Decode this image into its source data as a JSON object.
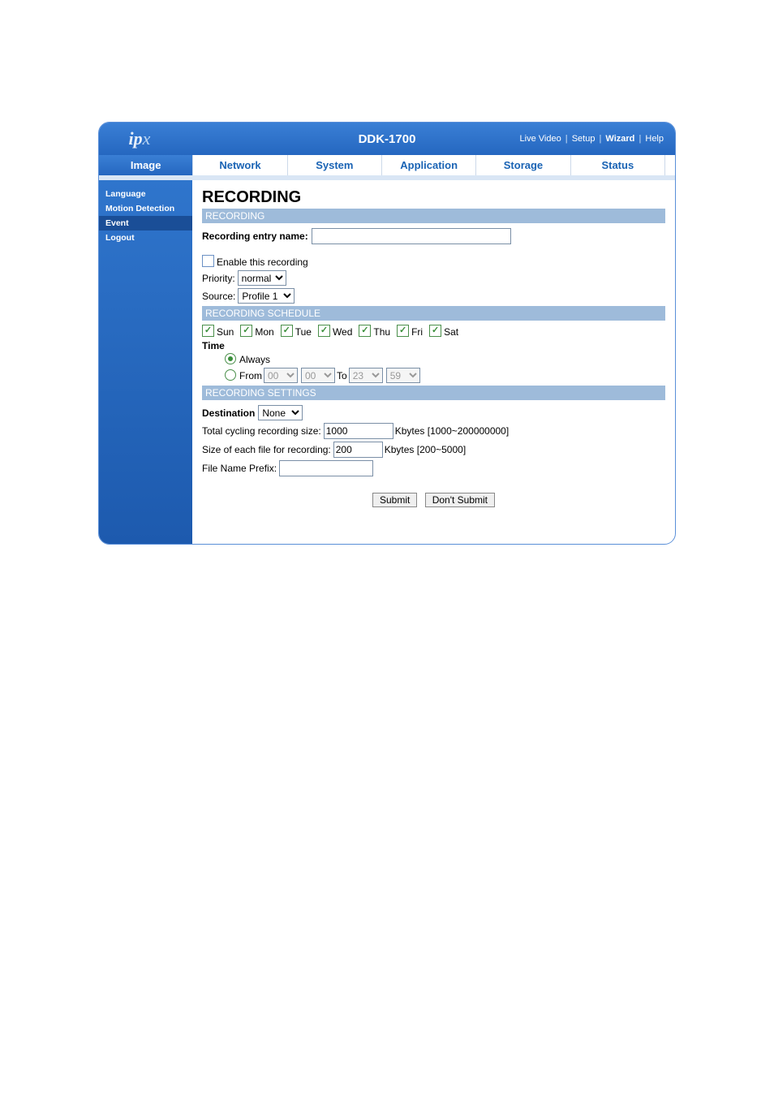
{
  "header": {
    "logo": "ipx",
    "title": "DDK-1700",
    "links": {
      "live": "Live Video",
      "setup": "Setup",
      "wizard": "Wizard",
      "help": "Help"
    }
  },
  "tabs": {
    "image": "Image",
    "network": "Network",
    "system": "System",
    "application": "Application",
    "storage": "Storage",
    "status": "Status"
  },
  "sidebar": {
    "language": "Language",
    "motion": "Motion Detection",
    "event": "Event",
    "logout": "Logout"
  },
  "content": {
    "page_title": "RECORDING",
    "sec_recording": "RECORDING",
    "entry_label": "Recording entry name:",
    "entry_value": "",
    "enable_label": "Enable this recording",
    "priority_label": "Priority:",
    "priority_value": "normal",
    "source_label": "Source:",
    "source_value": "Profile 1",
    "sec_schedule": "RECORDING SCHEDULE",
    "days": {
      "sun": "Sun",
      "mon": "Mon",
      "tue": "Tue",
      "wed": "Wed",
      "thu": "Thu",
      "fri": "Fri",
      "sat": "Sat"
    },
    "time_label": "Time",
    "always_label": "Always",
    "from_label": "From",
    "to_label": "To",
    "from_hh": "00",
    "from_mm": "00",
    "to_hh": "23",
    "to_mm": "59",
    "sec_settings": "RECORDING SETTINGS",
    "dest_label": "Destination",
    "dest_value": "None",
    "total_label": "Total cycling recording size:",
    "total_value": "1000",
    "total_unit": "Kbytes [1000~200000000]",
    "each_label": "Size of each file for recording:",
    "each_value": "200",
    "each_unit": "Kbytes [200~5000]",
    "prefix_label": "File Name Prefix:",
    "prefix_value": "",
    "submit": "Submit",
    "dont_submit": "Don't Submit"
  }
}
